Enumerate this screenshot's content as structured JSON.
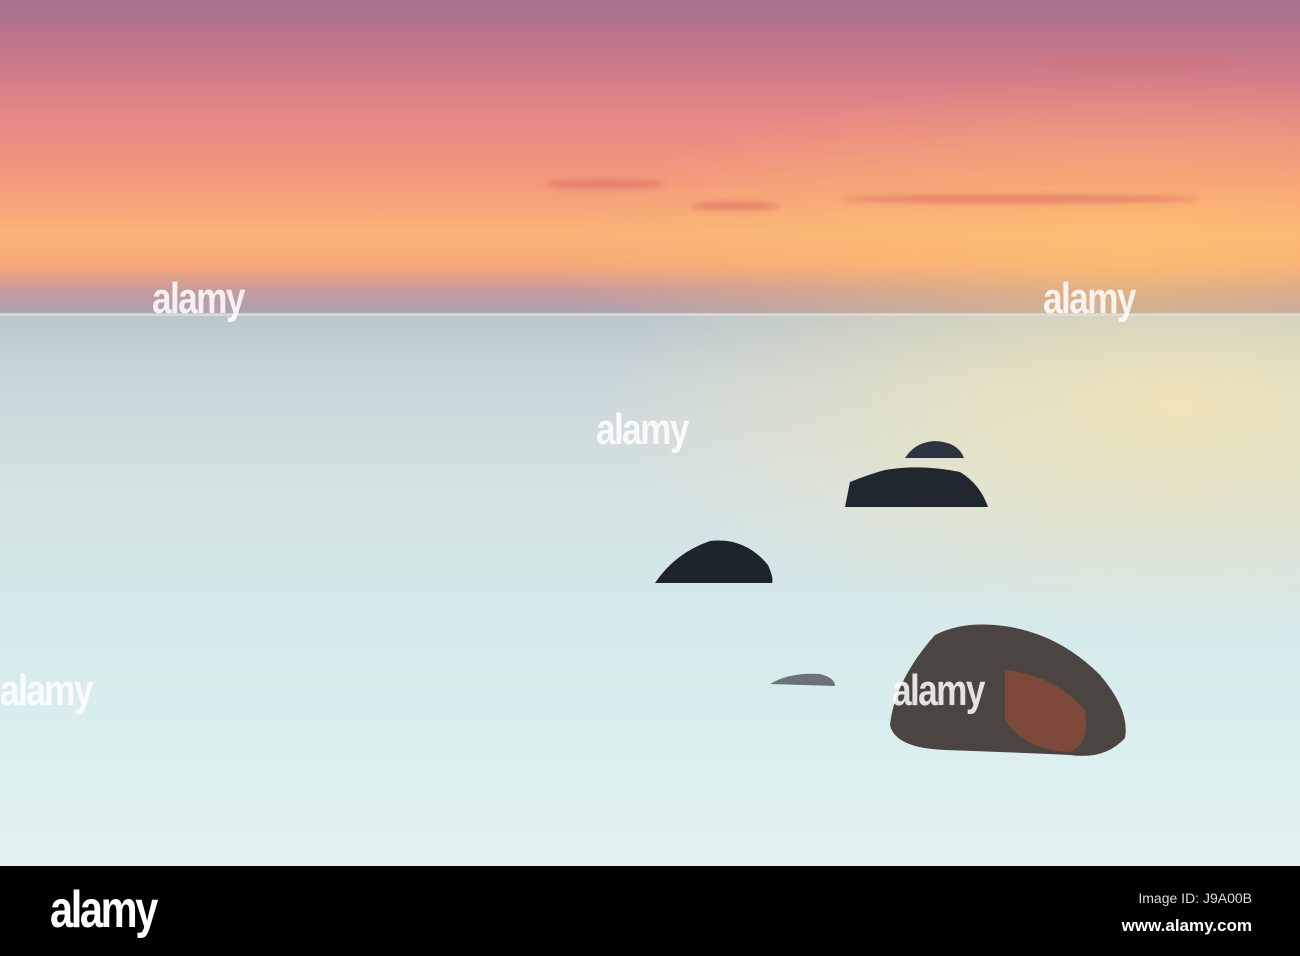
{
  "watermark": "alamy",
  "footer": {
    "logo": "alamy",
    "image_id": "Image ID: J9A00B",
    "url": "www.alamy.com"
  }
}
